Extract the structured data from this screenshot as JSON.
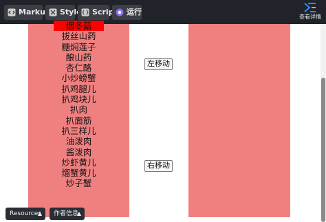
{
  "toolbar": {
    "tabs": [
      {
        "label": "Markup"
      },
      {
        "label": "Style"
      },
      {
        "label": "Script"
      },
      {
        "label": "运行"
      }
    ],
    "view_details_label": "查看详情"
  },
  "left_list": {
    "items": [
      "烟冬菇",
      "拔丝山药",
      "糖焖莲子",
      "酿山药",
      "杏仁酪",
      "小炒螃蟹",
      "扒鸡腿儿",
      "扒鸡块儿",
      "扒肉",
      "扒面筋",
      "扒三样儿",
      "油泼肉",
      "酱泼肉",
      "炒虾黄儿",
      "熘蟹黄儿",
      "炒子蟹"
    ],
    "selected_index": 0
  },
  "buttons": {
    "move_left": "左移动",
    "move_right": "右移动"
  },
  "footer": {
    "resources": "Resources",
    "author": "作者信息"
  },
  "colors": {
    "topbar": "#20242a",
    "panel": "#f08080",
    "selected": "#ff0000"
  },
  "icons": {
    "markup": "markup-icon",
    "style": "style-icon",
    "script": "script-icon",
    "run": "run-icon",
    "view_details": "view-details-icon",
    "chevron": "chevron-up-icon"
  }
}
